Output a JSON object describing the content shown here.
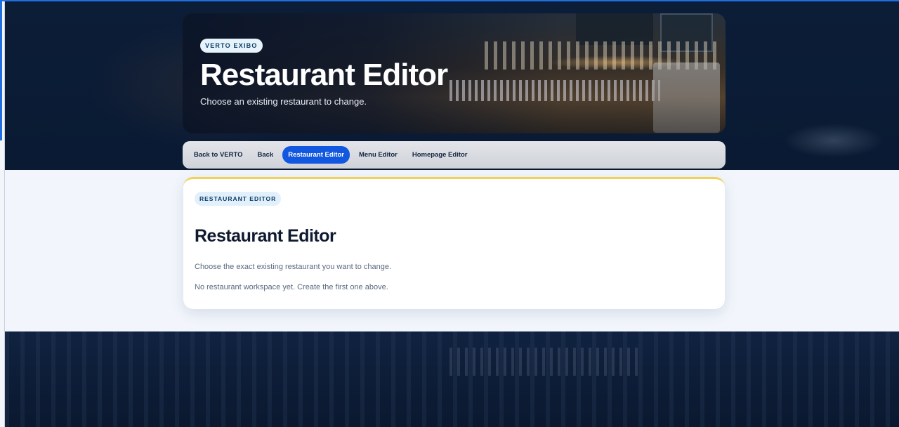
{
  "hero": {
    "badge": "VERTO EXIBO",
    "title": "Restaurant Editor",
    "subtitle": "Choose an existing restaurant to change."
  },
  "nav": {
    "items": [
      {
        "label": "Back to VERTO",
        "active": false
      },
      {
        "label": "Back",
        "active": false
      },
      {
        "label": "Restaurant Editor",
        "active": true
      },
      {
        "label": "Menu Editor",
        "active": false
      },
      {
        "label": "Homepage Editor",
        "active": false
      }
    ]
  },
  "card": {
    "badge": "RESTAURANT EDITOR",
    "title": "Restaurant Editor",
    "description": "Choose the exact existing restaurant you want to change.",
    "empty_state": "No restaurant workspace yet. Create the first one above."
  },
  "colors": {
    "accent": "#1257e0",
    "card_top_border": "#f2d15a",
    "background_dark": "#0b1a33",
    "content_band": "#f2f6fc"
  }
}
